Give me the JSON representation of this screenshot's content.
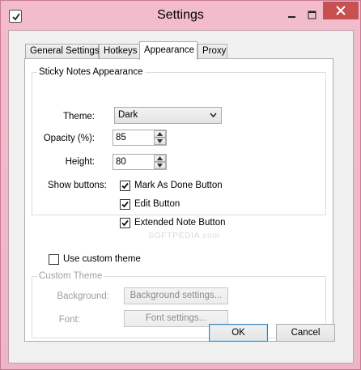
{
  "window": {
    "title": "Settings",
    "colors": {
      "frame": "#f3bccb",
      "close_button": "#c75050",
      "default_button_border": "#3c7fb1"
    }
  },
  "tabs": [
    {
      "label": "General Settings",
      "active": false
    },
    {
      "label": "Hotkeys",
      "active": false
    },
    {
      "label": "Appearance",
      "active": true
    },
    {
      "label": "Proxy",
      "active": false
    }
  ],
  "sticky_notes_appearance": {
    "legend": "Sticky Notes Appearance",
    "theme_label": "Theme:",
    "theme_value": "Dark",
    "opacity_label": "Opacity (%):",
    "opacity_value": "85",
    "height_label": "Height:",
    "height_value": "80",
    "show_buttons_label": "Show buttons:",
    "buttons": [
      {
        "label": "Mark As Done Button",
        "checked": true
      },
      {
        "label": "Edit Button",
        "checked": true
      },
      {
        "label": "Extended Note Button",
        "checked": true
      }
    ]
  },
  "use_custom_theme": {
    "label": "Use custom theme",
    "checked": false
  },
  "custom_theme": {
    "legend": "Custom Theme",
    "background_label": "Background:",
    "background_button": "Background settings...",
    "font_label": "Font:",
    "font_button": "Font settings..."
  },
  "footer": {
    "ok_label": "OK",
    "cancel_label": "Cancel"
  },
  "watermark": "SOFTPEDIA.com",
  "icons": [
    "app-checkbox-icon",
    "minimize-icon",
    "maximize-icon",
    "close-icon",
    "dropdown-arrow-icon",
    "spin-up-icon",
    "spin-down-icon",
    "checkmark-icon"
  ]
}
